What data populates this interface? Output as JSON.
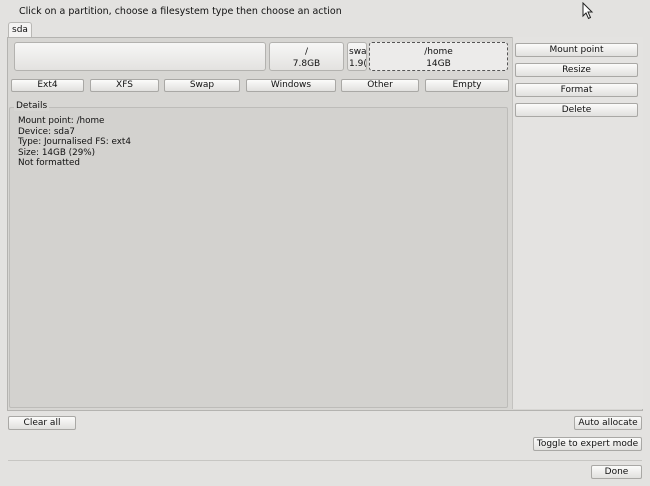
{
  "instruction": "Click on a partition, choose a filesystem type then choose an action",
  "disk_tab": "sda",
  "partitions": [
    {
      "mount": "",
      "size": "",
      "selected": false
    },
    {
      "mount": "/",
      "size": "7.8GB",
      "selected": false
    },
    {
      "mount": "swa",
      "size": "1.9(",
      "selected": false
    },
    {
      "mount": "/home",
      "size": "14GB",
      "selected": true
    }
  ],
  "fs_types": [
    "Ext4",
    "XFS",
    "Swap",
    "Windows",
    "Other",
    "Empty"
  ],
  "actions": [
    "Mount point",
    "Resize",
    "Format",
    "Delete"
  ],
  "details": {
    "legend": "Details",
    "lines": [
      "Mount point: /home",
      "Device: sda7",
      "Type: Journalised FS: ext4",
      "Size: 14GB (29%)",
      "Not formatted"
    ]
  },
  "bottom": {
    "clear_all": "Clear all",
    "auto_allocate": "Auto allocate",
    "expert_mode": "Toggle to expert mode",
    "done": "Done"
  }
}
